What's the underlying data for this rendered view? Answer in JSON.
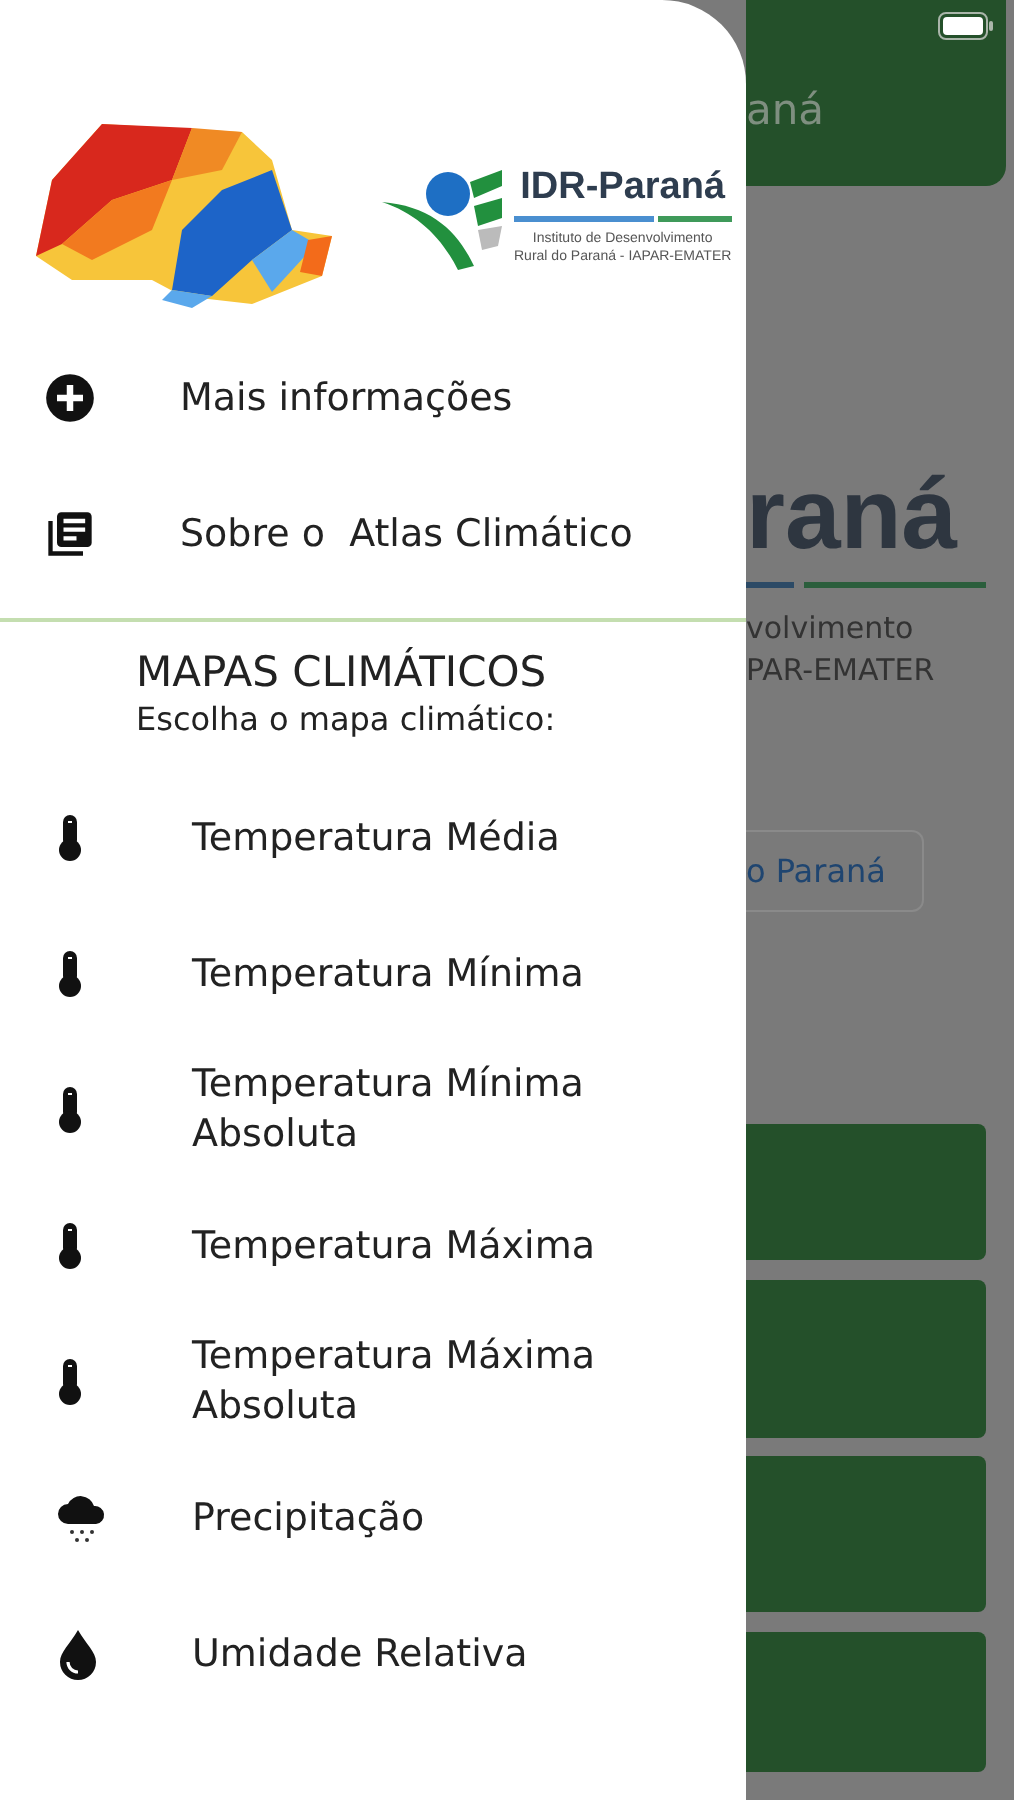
{
  "drawer": {
    "logo": {
      "title": "IDR-Paraná",
      "subtitle_lines": [
        "Instituto de Desenvolvimento",
        "Rural do Paraná - IAPAR-EMATER"
      ]
    },
    "links": [
      {
        "kind": "plus",
        "label": "Mais informações"
      },
      {
        "kind": "book",
        "label": "Sobre o  Atlas Climático"
      }
    ],
    "section": {
      "title": "MAPAS CLIMÁTICOS",
      "subtitle": "Escolha o mapa climático:"
    },
    "maps": [
      {
        "kind": "thermometer",
        "label": "Temperatura Média"
      },
      {
        "kind": "thermometer",
        "label": "Temperatura Mínima"
      },
      {
        "kind": "thermometer",
        "label": "Temperatura Mínima Absoluta"
      },
      {
        "kind": "thermometer",
        "label": "Temperatura Máxima"
      },
      {
        "kind": "thermometer",
        "label": "Temperatura Máxima Absoluta"
      },
      {
        "kind": "rain",
        "label": "Precipitação"
      },
      {
        "kind": "drop",
        "label": "Umidade Relativa"
      }
    ]
  },
  "background": {
    "header_title": "aná",
    "brand": "raná",
    "brand_lines": [
      "volvimento",
      "PAR-EMATER"
    ],
    "button": "o Paraná"
  }
}
